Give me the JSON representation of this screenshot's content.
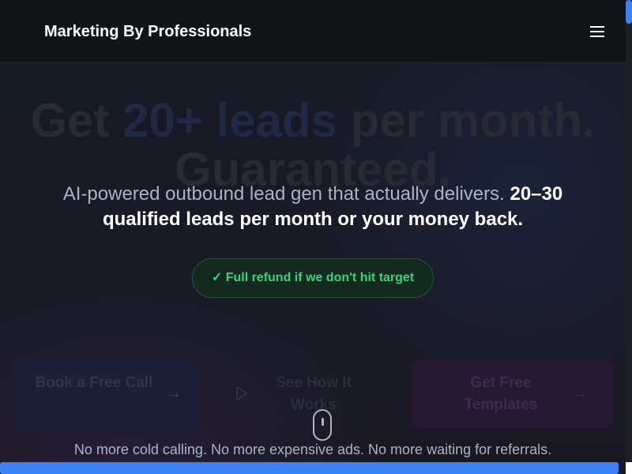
{
  "header": {
    "brand": "Marketing By Professionals",
    "menu_icon": "hamburger-menu-icon"
  },
  "hero": {
    "headline_part1": "Get ",
    "headline_highlight": "20+ leads",
    "headline_part2": " per month.",
    "headline_line2": "Guaranteed.",
    "subtitle_plain": "AI-powered outbound lead gen that actually delivers. ",
    "subtitle_bold": "20–30 qualified leads per month or your money back.",
    "refund_badge": "✓ Full refund if we don't hit target",
    "tagline": "No more cold calling. No more expensive ads. No more waiting for referrals."
  },
  "cta": {
    "book_label": "Book a Free Call",
    "how_label": "See How It Works",
    "templates_label": "Get Free Templates",
    "arrow_icon": "arrow-right-icon",
    "play_icon": "play-icon"
  },
  "colors": {
    "accent": "#3b82f6",
    "success": "#3ed17c",
    "background": "#14151a"
  }
}
